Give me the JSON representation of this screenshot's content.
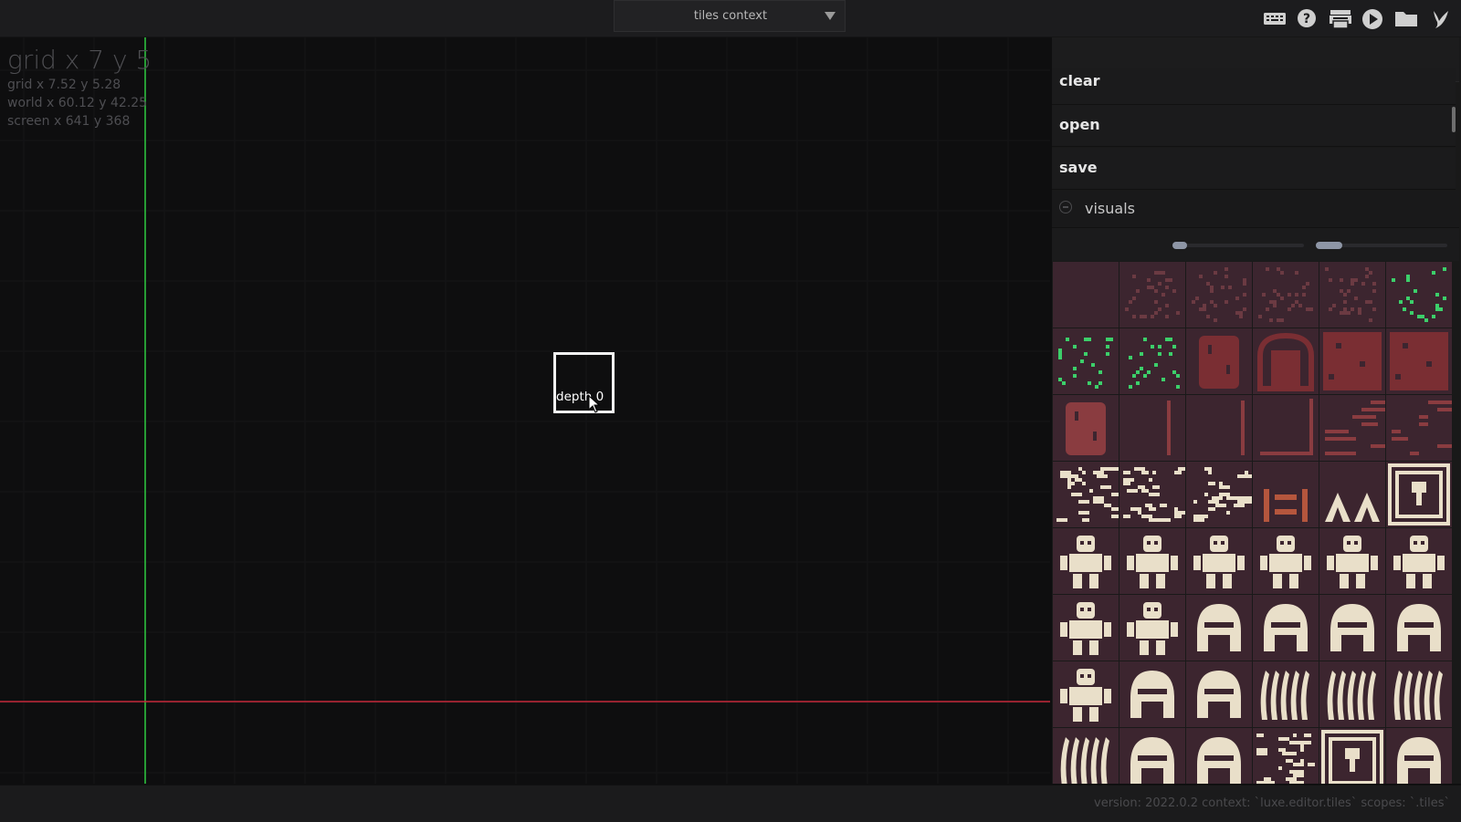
{
  "toolbar": {
    "context_dropdown": {
      "value": "tiles context"
    },
    "icons": [
      "keyboard-icon",
      "help-icon",
      "printer-icon",
      "play-icon",
      "folder-icon",
      "luxe-logo-icon"
    ]
  },
  "viewport": {
    "coord_main": "grid x 7 y 5",
    "coord_grid": "grid x 7.52 y 5.28",
    "coord_world": "world x 60.12 y 42.25",
    "coord_screen": "screen x 641 y 368",
    "depth_label": "depth 0",
    "axis_colors": {
      "x_axis": "#c4283a",
      "y_axis": "#2ecc40"
    }
  },
  "panel": {
    "menu": [
      {
        "label": "clear"
      },
      {
        "label": "open"
      },
      {
        "label": "save"
      }
    ],
    "visuals_label": "visuals",
    "sliders": [
      {
        "name": "tile-size-slider",
        "value": 0.1
      },
      {
        "name": "tile-spacing-slider",
        "value": 0.2
      }
    ],
    "palette": {
      "tile_bg": "#3c252f",
      "dirt": "#6b3a42",
      "grass": "#3ccf6a",
      "brick": "#7a2e33",
      "wall": "#8a3c40",
      "bone": "#e9dfc9",
      "orange": "#b5563d"
    },
    "tiles": [
      {
        "kind": "empty",
        "color": "dirt"
      },
      {
        "kind": "speckle",
        "color": "dirt"
      },
      {
        "kind": "speckle",
        "color": "dirt"
      },
      {
        "kind": "speckle",
        "color": "dirt"
      },
      {
        "kind": "speckle",
        "color": "dirt"
      },
      {
        "kind": "grass",
        "color": "grass"
      },
      {
        "kind": "grass",
        "color": "grass"
      },
      {
        "kind": "grass",
        "color": "grass"
      },
      {
        "kind": "door",
        "color": "brick"
      },
      {
        "kind": "arch",
        "color": "brick"
      },
      {
        "kind": "block",
        "color": "brick"
      },
      {
        "kind": "block",
        "color": "brick"
      },
      {
        "kind": "door",
        "color": "wall"
      },
      {
        "kind": "line",
        "color": "wall"
      },
      {
        "kind": "line",
        "color": "wall"
      },
      {
        "kind": "corner",
        "color": "wall"
      },
      {
        "kind": "maze",
        "color": "wall"
      },
      {
        "kind": "maze",
        "color": "wall"
      },
      {
        "kind": "glyph",
        "color": "bone"
      },
      {
        "kind": "glyph",
        "color": "bone"
      },
      {
        "kind": "glyph",
        "color": "bone"
      },
      {
        "kind": "ladder",
        "color": "orange"
      },
      {
        "kind": "spikes",
        "color": "bone"
      },
      {
        "kind": "frame",
        "color": "bone"
      },
      {
        "kind": "figure",
        "color": "bone"
      },
      {
        "kind": "figure",
        "color": "bone"
      },
      {
        "kind": "figure",
        "color": "bone"
      },
      {
        "kind": "figure",
        "color": "bone"
      },
      {
        "kind": "figure",
        "color": "bone"
      },
      {
        "kind": "figure",
        "color": "bone"
      },
      {
        "kind": "figure",
        "color": "bone"
      },
      {
        "kind": "figure",
        "color": "bone"
      },
      {
        "kind": "helmet",
        "color": "bone"
      },
      {
        "kind": "helmet",
        "color": "bone"
      },
      {
        "kind": "helmet",
        "color": "bone"
      },
      {
        "kind": "helmet",
        "color": "bone"
      },
      {
        "kind": "figure",
        "color": "bone"
      },
      {
        "kind": "helmet",
        "color": "bone"
      },
      {
        "kind": "helmet",
        "color": "bone"
      },
      {
        "kind": "claw",
        "color": "bone"
      },
      {
        "kind": "claw",
        "color": "bone"
      },
      {
        "kind": "claw",
        "color": "bone"
      },
      {
        "kind": "claw",
        "color": "bone"
      },
      {
        "kind": "helmet",
        "color": "bone"
      },
      {
        "kind": "helmet",
        "color": "bone"
      },
      {
        "kind": "glyph",
        "color": "bone"
      },
      {
        "kind": "frame",
        "color": "bone"
      },
      {
        "kind": "helmet",
        "color": "bone"
      }
    ]
  },
  "status": {
    "text": "version: 2022.0.2 context: `luxe.editor.tiles` scopes: `.tiles`"
  }
}
